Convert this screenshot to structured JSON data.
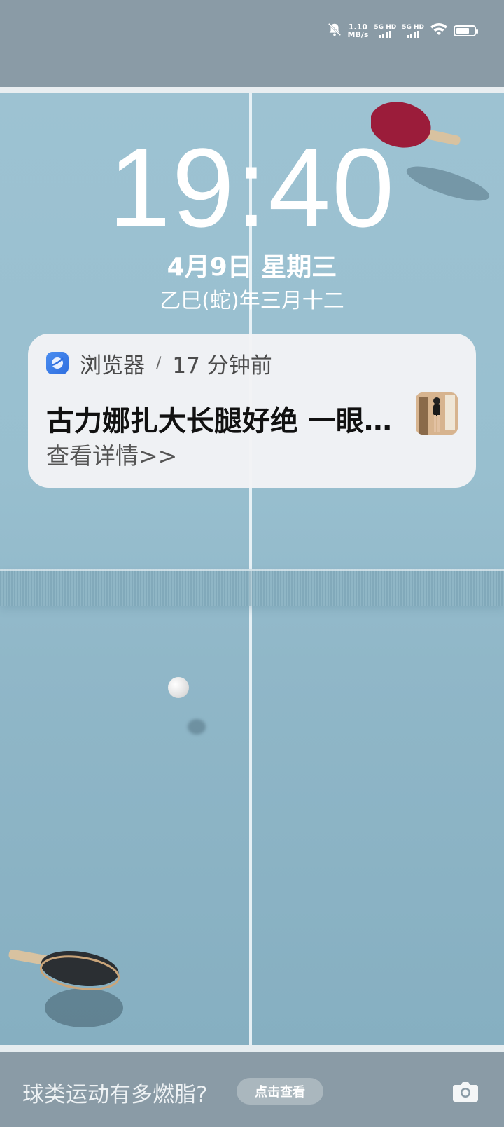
{
  "status_bar": {
    "mute_icon": "bell-off-icon",
    "net_speed_value": "1.10",
    "net_speed_unit": "MB/s",
    "sim1_label": "5G HD",
    "sim2_label": "5G HD",
    "wifi_icon": "wifi-icon",
    "battery_level": 0.8
  },
  "lockscreen": {
    "time": "19:40",
    "date": "4月9日 星期三",
    "lunar_date": "乙巳(蛇)年三月十二"
  },
  "notification": {
    "app_icon": "browser-icon",
    "app_name": "浏览器",
    "separator": "/",
    "time_ago": "17 分钟前",
    "title": "古力娜扎大长腿好绝 一眼…",
    "body": "查看详情>>"
  },
  "bottom_bar": {
    "promo_text": "球类运动有多燃脂?",
    "promo_button": "点击查看",
    "camera_icon": "camera-icon"
  },
  "colors": {
    "table_blue": "#98bfcf",
    "band_gray": "#8a9ba6",
    "paddle_red": "#9b1c3a",
    "paddle_black": "#2b2f33",
    "browser_blue": "#2f6fe0"
  }
}
